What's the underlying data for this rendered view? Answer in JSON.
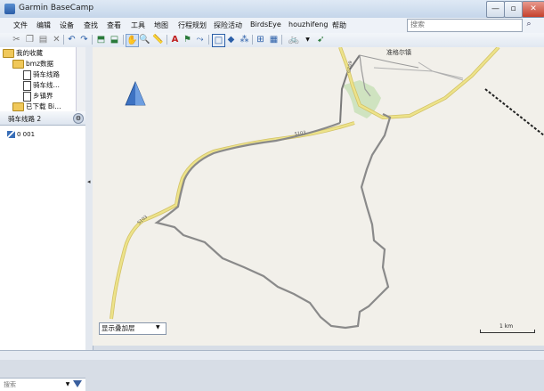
{
  "window": {
    "title": "Garmin BaseCamp",
    "close_label": "✕"
  },
  "menu": [
    "文件",
    "编辑",
    "设备",
    "查找",
    "查看",
    "工具",
    "地图",
    "行程规划",
    "探险活动",
    "BirdsEye",
    "houzhifeng",
    "帮助"
  ],
  "search": {
    "placeholder": "搜索"
  },
  "tree": {
    "items": [
      {
        "label": "我的收藏",
        "level": 0,
        "type": "folder"
      },
      {
        "label": "bmz数据",
        "level": 1,
        "type": "folder"
      },
      {
        "label": "骑车线路",
        "level": 2,
        "type": "doc"
      },
      {
        "label": "骑车线…",
        "level": 2,
        "type": "doc"
      },
      {
        "label": "乡镇界",
        "level": 2,
        "type": "doc"
      },
      {
        "label": "已下载 Bi…",
        "level": 1,
        "type": "folder"
      }
    ]
  },
  "list": {
    "title": "骑车线路 2",
    "item": "0 001"
  },
  "filter": {
    "placeholder": "搜索"
  },
  "map": {
    "place_label": "准格尔镇",
    "road_labels": [
      "S103",
      "S103",
      "G109"
    ],
    "layer_select": "显示叠加层",
    "scale": "1 km",
    "route_color": "#8a8a8a",
    "road_color": "#ede38a",
    "road_outline": "#d3c266",
    "park_color": "#cfe3c0"
  }
}
